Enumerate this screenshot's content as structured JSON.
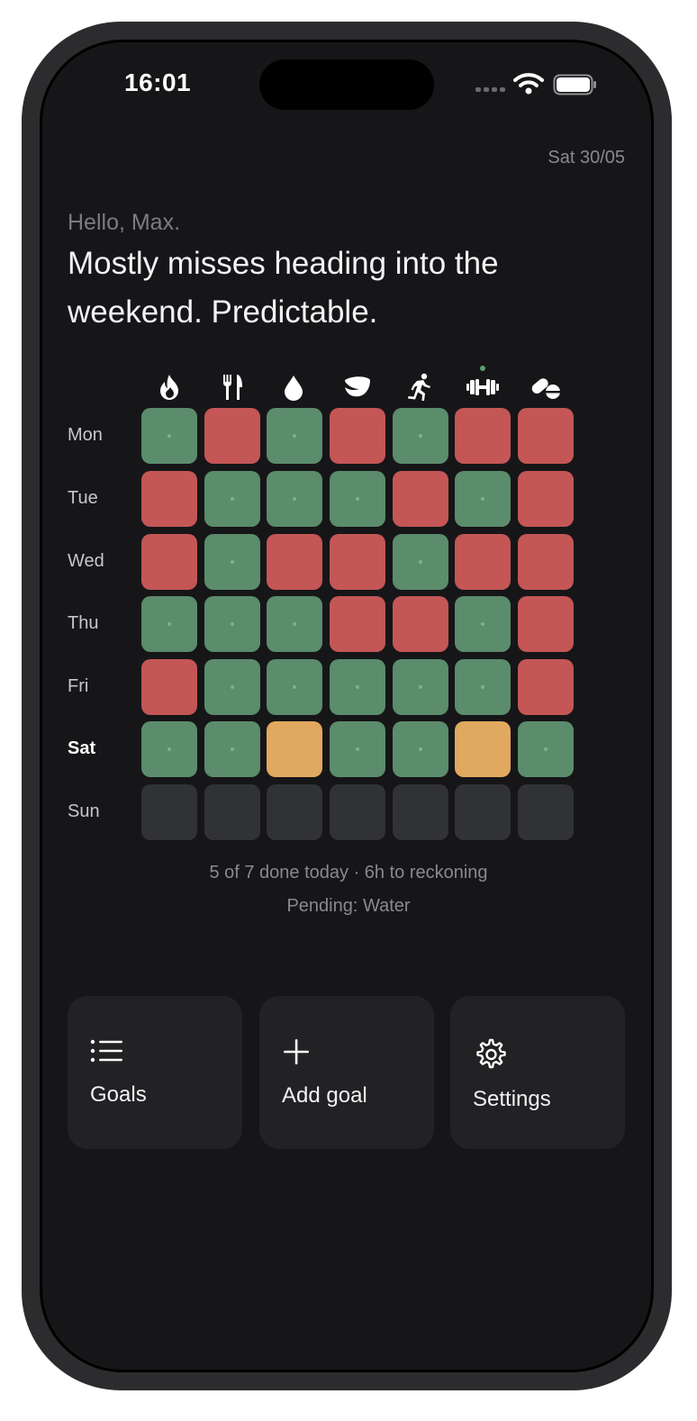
{
  "status_bar": {
    "time": "16:01"
  },
  "header": {
    "date": "Sat 30/05"
  },
  "greeting": {
    "hello": "Hello, Max.",
    "message": "Mostly misses heading into the weekend. Predictable."
  },
  "goals": [
    {
      "icon": "flame-icon"
    },
    {
      "icon": "fork-knife-icon"
    },
    {
      "icon": "water-drop-icon"
    },
    {
      "icon": "leaf-icon"
    },
    {
      "icon": "running-icon"
    },
    {
      "icon": "dumbbell-icon"
    },
    {
      "icon": "pills-icon"
    }
  ],
  "grid": {
    "days": [
      "Mon",
      "Tue",
      "Wed",
      "Thu",
      "Fri",
      "Sat",
      "Sun"
    ],
    "today": "Sat",
    "rows": [
      [
        "done",
        "miss",
        "done",
        "miss",
        "done",
        "miss",
        "miss"
      ],
      [
        "miss",
        "done",
        "done",
        "done",
        "miss",
        "done",
        "miss"
      ],
      [
        "miss",
        "done",
        "miss",
        "miss",
        "done",
        "miss",
        "miss"
      ],
      [
        "done",
        "done",
        "done",
        "miss",
        "miss",
        "done",
        "miss"
      ],
      [
        "miss",
        "done",
        "done",
        "done",
        "done",
        "done",
        "miss"
      ],
      [
        "done",
        "done",
        "pending",
        "done",
        "done",
        "pending",
        "done"
      ],
      [
        "future",
        "future",
        "future",
        "future",
        "future",
        "future",
        "future"
      ]
    ],
    "colors": {
      "done": "#5b8c6c",
      "miss": "#c45656",
      "pending": "#e1a85f",
      "future": "#313236"
    }
  },
  "summary": {
    "progress": "5 of 7 done today · 6h to reckoning",
    "pending": "Pending: Water"
  },
  "actions": [
    {
      "icon": "list-icon",
      "label": "Goals"
    },
    {
      "icon": "plus-icon",
      "label": "Add goal"
    },
    {
      "icon": "gear-icon",
      "label": "Settings"
    }
  ]
}
